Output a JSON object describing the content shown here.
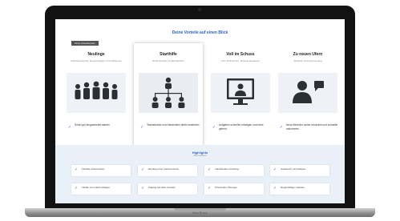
{
  "page": {
    "title": "Deine Vorteile auf einen Blick",
    "badge": "Ohne Zusatzkosten"
  },
  "laptop": {
    "brand": "MacBook"
  },
  "columns": [
    {
      "title": "Neulinge",
      "subtitle": "Arbeitssuchende, Neueinsteiger in Produktionen",
      "illustration": "group-of-people-icon",
      "feature": "Sofort gut eingearbeitet starten"
    },
    {
      "title": "Starthilfe",
      "subtitle": "Erste Schritte ins Berufsleben",
      "illustration": "org-chart-icon",
      "feature": "Teamstruktur und Hierarchien direkt verstehen"
    },
    {
      "title": "Voll im Schuss",
      "subtitle": "Vom Profi lernen, Routine ausbauen",
      "illustration": "video-call-icon",
      "feature": "Aufgaben schneller erledigen und mehr gelernt"
    },
    {
      "title": "Zu neuen Ufern",
      "subtitle": "Wechsel und Quereinstieg",
      "illustration": "person-speech-icon",
      "feature": "Neue Bereiche sicher erkunden und schneller ankommen"
    }
  ],
  "highlights": {
    "title": "Highlights",
    "subtitle": "Alles inklusive",
    "items": [
      "Flexible Arbeitszeiten",
      "Einstieg ohne Vorkenntnisse",
      "Individuelles Coaching",
      "Austausch mit Kollegen",
      "Inhalte zum Nachschlagen",
      "Zugang auf allen Geräten",
      "Praxisnahe Übungen",
      "Regelmäßige Updates"
    ]
  },
  "colors": {
    "accent": "#2b5fc7",
    "illustration": "#2b2f36",
    "band": "#eaf0f7"
  }
}
